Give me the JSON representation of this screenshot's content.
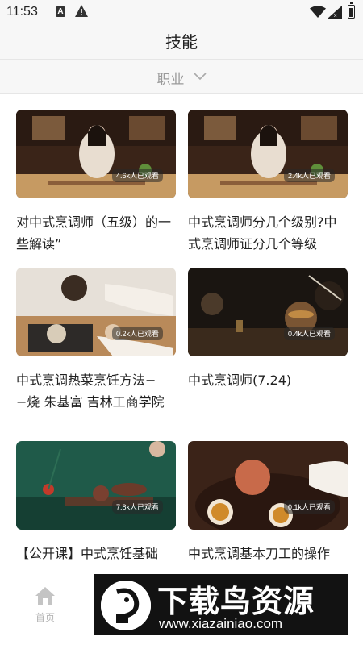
{
  "status_bar": {
    "time": "11:53",
    "icons": [
      "text-a-icon",
      "warning-icon",
      "wifi-icon",
      "signal-icon",
      "battery-icon"
    ]
  },
  "header": {
    "title": "技能"
  },
  "filter": {
    "label": "职业",
    "icon": "chevron-down-icon"
  },
  "cards": [
    {
      "title": "对中式烹调师（五级）的一些解读”",
      "views": "4.6k人已观看",
      "thumb_colors": [
        "#3a2418",
        "#d9c7a8"
      ]
    },
    {
      "title": "中式烹调师分几个级别?中式烹调师证分几个等级",
      "views": "2.4k人已观看",
      "thumb_colors": [
        "#3a2418",
        "#d9c7a8"
      ]
    },
    {
      "title": "中式烹调热菜烹饪方法−−烧 朱基富 吉林工商学院",
      "views": "0.2k人已观看",
      "thumb_colors": [
        "#e3ddd4",
        "#4b3a2e"
      ]
    },
    {
      "title": "中式烹调师(7.24)",
      "views": "0.4k人已观看",
      "thumb_colors": [
        "#1c1712",
        "#7a5a33"
      ]
    },
    {
      "title": "【公开课】中式烹饪基础",
      "views": "7.8k人已观看",
      "thumb_colors": [
        "#1f5a49",
        "#6b3b2a"
      ]
    },
    {
      "title": "中式烹调基本刀工的操作",
      "views": "0.1k人已观看",
      "thumb_colors": [
        "#3b2318",
        "#c86a4a"
      ]
    }
  ],
  "bottom_nav": {
    "home_label": "首页",
    "home_icon": "home-icon"
  },
  "watermark": {
    "brand": "下载鸟资源",
    "url": "www.xiazainiao.com"
  }
}
